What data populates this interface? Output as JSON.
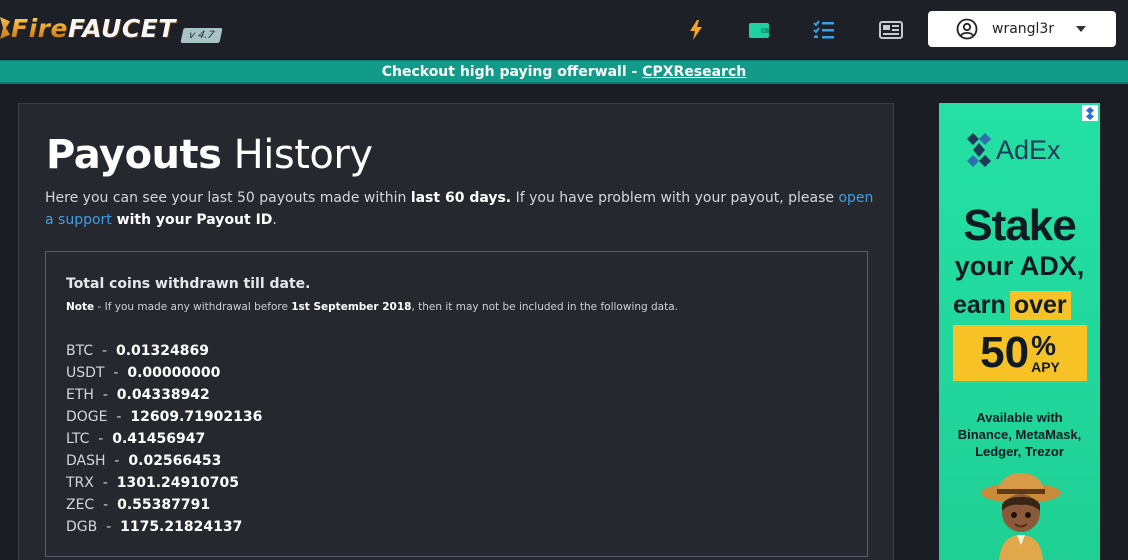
{
  "navbar": {
    "logo_fire": "Fire",
    "logo_faucet": "FAUCET",
    "version": "v 4.7",
    "icons": [
      "lightning-icon",
      "wallet-icon",
      "tasks-icon",
      "newspaper-icon"
    ],
    "username": "wrangl3r"
  },
  "announcement": {
    "text": "Checkout high paying offerwall - ",
    "link": "CPXResearch"
  },
  "main": {
    "title_bold": "Payouts",
    "title_rest": " History",
    "intro_1": "Here you can see your last 50 payouts made within ",
    "intro_bold_1": "last 60 days.",
    "intro_2": " If you have problem with your payout, please ",
    "intro_link": "open a support",
    "intro_bold_2": " with your Payout ID",
    "intro_end": "."
  },
  "summary": {
    "title": "Total coins withdrawn till date.",
    "note_label": "Note",
    "note_1": " - If you made any withdrawal before ",
    "note_date": "1st September 2018",
    "note_2": ", then it may not be included in the following data.",
    "coins": [
      {
        "symbol": "BTC",
        "amount": "0.01324869"
      },
      {
        "symbol": "USDT",
        "amount": "0.00000000"
      },
      {
        "symbol": "ETH",
        "amount": "0.04338942"
      },
      {
        "symbol": "DOGE",
        "amount": "12609.71902136"
      },
      {
        "symbol": "LTC",
        "amount": "0.41456947"
      },
      {
        "symbol": "DASH",
        "amount": "0.02566453"
      },
      {
        "symbol": "TRX",
        "amount": "1301.24910705"
      },
      {
        "symbol": "ZEC",
        "amount": "0.55387791"
      },
      {
        "symbol": "DGB",
        "amount": "1175.21824137"
      }
    ]
  },
  "ad": {
    "brand": "AdEx",
    "line1": "Stake",
    "line2": "your ADX,",
    "line3_a": "earn",
    "line3_b": "over",
    "big": "50",
    "pct": "%",
    "apy": "APY",
    "avail_1": "Available with",
    "avail_2": "Binance, MetaMask,",
    "avail_3": "Ledger, Trezor",
    "colors": {
      "bg": "#22d89c",
      "highlight": "#f6c226",
      "text": "#0f1a22"
    }
  },
  "colors": {
    "navbar": "#1e2028",
    "announce": "#119b88",
    "card": "#262830",
    "link": "#3ea0e4"
  }
}
